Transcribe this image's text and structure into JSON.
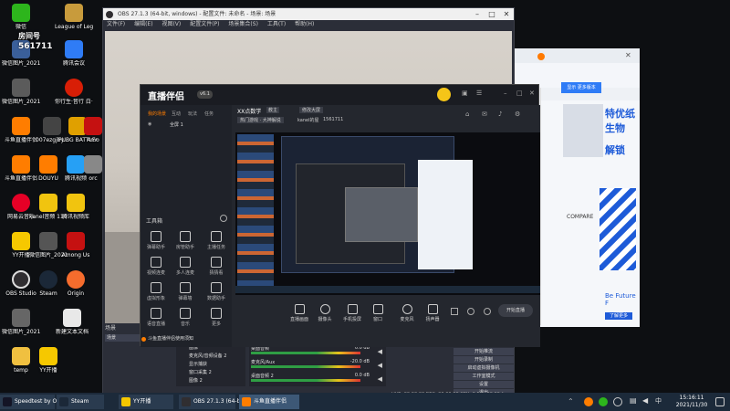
{
  "desktop": {
    "icons": [
      {
        "label": "微信",
        "color": "#2db51c"
      },
      {
        "label": "League of Legends",
        "color": "#c89b3c"
      },
      {
        "label": "微信图片_2021110...",
        "color": "#3a5f9a"
      },
      {
        "label": "腾讯会议",
        "color": "#2f7cf6"
      },
      {
        "label": "微信图片_2021110...",
        "color": "#5b5b5b"
      },
      {
        "label": "你行生·音行 白·兰",
        "color": "#d81e06"
      },
      {
        "label": "斗鱼直播伴侣",
        "color": "#ff7d00"
      },
      {
        "label": "007ezgjby...",
        "color": "#444"
      },
      {
        "label": "PUBG BATTLEGR...",
        "color": "#e0a000"
      },
      {
        "label": "Amo",
        "color": "#c51111"
      },
      {
        "label": "斗鱼直播伴侣",
        "color": "#ff7d00"
      },
      {
        "label": "DOUYU",
        "color": "#ff7d00"
      },
      {
        "label": "腾讯视频",
        "color": "#26a0f5"
      },
      {
        "label": "orc",
        "color": "#888"
      },
      {
        "label": "网易云音乐",
        "color": "#e60026"
      },
      {
        "label": "kanel音频 1109",
        "color": "#f1c40f"
      },
      {
        "label": "腾讯视频库",
        "color": "#26a0f5"
      },
      {
        "label": "YY开播",
        "color": "#f6c800"
      },
      {
        "label": "微信图片_2021110...",
        "color": "#555"
      },
      {
        "label": "Among Us",
        "color": "#c51111"
      },
      {
        "label": "OBS Studio",
        "color": "#302e31"
      },
      {
        "label": "Steam",
        "color": "#1b2838"
      },
      {
        "label": "Origin",
        "color": "#f56c2d"
      },
      {
        "label": "微信图片_2021110...",
        "color": "#666"
      },
      {
        "label": "新建文本文档",
        "color": "#e8e8e8"
      },
      {
        "label": "temp",
        "color": "#f0c040"
      },
      {
        "label": "YY开播",
        "color": "#f6c800"
      }
    ],
    "overlay_room_label": "房间号",
    "overlay_room_number": "561711"
  },
  "obs": {
    "title": "OBS 27.1.3 (64-bit, windows) - 配置文件: 未命名 - 场景: 场景",
    "menu": [
      "文件(F)",
      "编辑(E)",
      "视图(V)",
      "配置文件(P)",
      "场景集合(S)",
      "工具(T)",
      "帮助(H)"
    ],
    "scenes_header": "场景",
    "sources": [
      "图像",
      "麦克风/音频设备 2",
      "显示捕获",
      "窗口采集 2",
      "图像 2"
    ],
    "mixer": [
      {
        "name": "桌面音频",
        "db": "0.0 dB"
      },
      {
        "name": "麦克风/Aux",
        "db": "-20.0 dB"
      },
      {
        "name": "桌面音频 2",
        "db": "0.0 dB"
      }
    ],
    "controls": [
      "开始推流",
      "开始录制",
      "启动虚拟摄像机",
      "工作室模式",
      "设置",
      "退出"
    ],
    "status": "LIVE: 00:00:00   REC: 00:00:00   CPU: 3.5%, 30.00 fps",
    "scene_name": "场景"
  },
  "companion": {
    "logo": "直播伴侣",
    "version_badge": "v6.1",
    "user_name": "XX点数学",
    "user_tag": "教主",
    "edit_label": "修改大屏",
    "category": "热门游戏 · 大神解说",
    "room_label": "kanel的屋",
    "room_id": "1561711",
    "side_tabs": [
      "我的场景",
      "互动",
      "玩法",
      "任务"
    ],
    "scene_item": "全屏 1",
    "tools_header": "工具箱",
    "tools": [
      "弹幕助手",
      "房管助手",
      "主播任务",
      "视频连麦",
      "多人连麦",
      "猜猜看",
      "虚拟形象",
      "弹幕墙",
      "数据助手",
      "语音直播",
      "音乐",
      "更多"
    ],
    "bottom_tools": [
      "直播画面",
      "摄像头",
      "手机投屏",
      "窗口",
      "麦克风",
      "扬声器"
    ],
    "start_button": "开始直播",
    "notice": "斗鱼直播伴侣使用须知"
  },
  "browser": {
    "search_button": "显示 更多版本",
    "headline_1": "特优纸",
    "headline_2": "生物",
    "headline_3": "解锁",
    "compare": "COMPARE",
    "tagline": "Be Future F",
    "blue_badge": "了解更多"
  },
  "taskbar": {
    "items": [
      {
        "label": "Speedtest by Oo...",
        "color": "#141526"
      },
      {
        "label": "Steam",
        "color": "#1b2838"
      },
      {
        "label": "YY开播",
        "color": "#f6c800"
      },
      {
        "label": "OBS 27.1.3 (64-bi...",
        "color": "#302e31"
      },
      {
        "label": "斗鱼直播伴侣",
        "color": "#ff7d00"
      }
    ],
    "time": "15:16:11",
    "date": "2021/11/30"
  }
}
